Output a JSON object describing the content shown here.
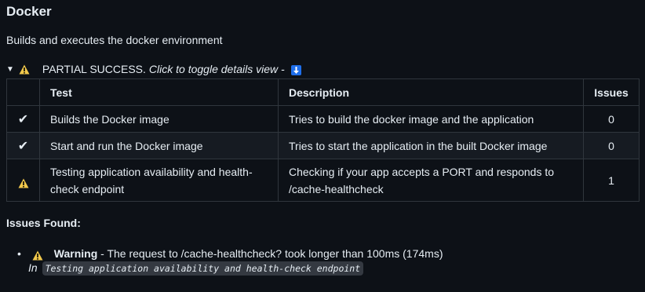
{
  "title": "Docker",
  "description": "Builds and executes the docker environment",
  "summary": {
    "status": "PARTIAL SUCCESS.",
    "toggle_text": "Click to toggle details view -",
    "status_icon": "warning-icon",
    "toggle_icon": "down-arrow-icon"
  },
  "table": {
    "headers": {
      "status": "",
      "test": "Test",
      "description": "Description",
      "issues": "Issues"
    },
    "rows": [
      {
        "status": "✔",
        "status_icon": "check-icon",
        "test": "Builds the Docker image",
        "description": "Tries to build the docker image and the application",
        "issues": "0"
      },
      {
        "status": "✔",
        "status_icon": "check-icon",
        "test": "Start and run the Docker image",
        "description": "Tries to start the application in the built Docker image",
        "issues": "0"
      },
      {
        "status": "",
        "status_icon": "warning-icon",
        "test": "Testing application availability and health-check endpoint",
        "description": "Checking if your app accepts a PORT and responds to /cache-healthcheck",
        "issues": "1"
      }
    ]
  },
  "issues_heading": "Issues Found:",
  "issues": [
    {
      "level": "Warning",
      "message": " - The request to /cache-healthcheck? took longer than 100ms (174ms)",
      "location_prefix": "In",
      "location": "Testing application availability and health-check endpoint"
    }
  ],
  "colors": {
    "background": "#0d1117",
    "text": "#e6edf3",
    "border": "#30363d",
    "warning": "#f2c94c",
    "toggle_button": "#1f6feb"
  }
}
